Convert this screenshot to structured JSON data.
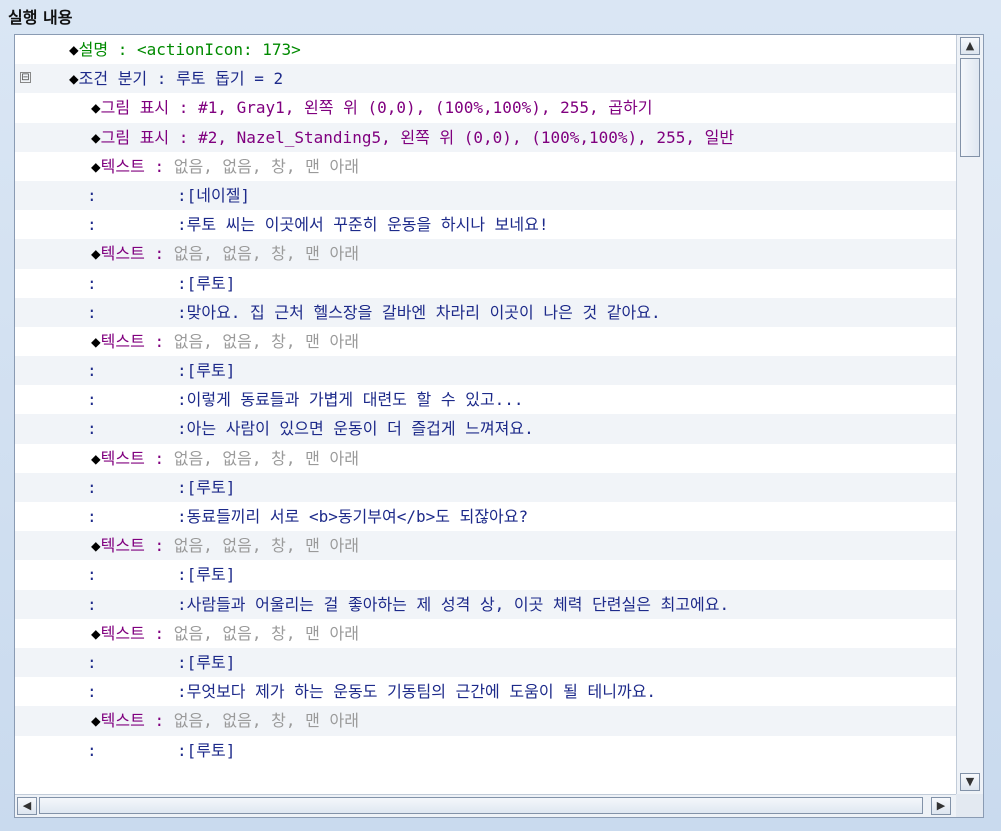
{
  "panel": {
    "title": "실행 내용"
  },
  "rows": [
    {
      "indent": 38,
      "marker": "◆",
      "label": "설명",
      "label_class": "green",
      "sep": " : ",
      "body": "<actionIcon: 173>",
      "body_class": "green"
    },
    {
      "indent": 38,
      "toggle": "⊟",
      "marker": "◆",
      "label": "조건 분기",
      "label_class": "navy",
      "sep": " : ",
      "body": "루토 돕기 = 2",
      "body_class": "navy"
    },
    {
      "indent": 60,
      "marker": "◆",
      "label": "그림 표시",
      "label_class": "purple",
      "sep": " : ",
      "body": "#1, Gray1, 왼쪽 위 (0,0), (100%,100%), 255, 곱하기",
      "body_class": "purple"
    },
    {
      "indent": 60,
      "marker": "◆",
      "label": "그림 표시",
      "label_class": "purple",
      "sep": " : ",
      "body": "#2, Nazel_Standing5, 왼쪽 위 (0,0), (100%,100%), 255, 일반",
      "body_class": "purple"
    },
    {
      "indent": 60,
      "marker": "◆",
      "label": "텍스트",
      "label_class": "purple",
      "sep": " : ",
      "body": "없음, 없음, 창, 맨 아래",
      "body_class": "gray"
    },
    {
      "cont": true,
      "colon": ":",
      "body": ":[네이젤]"
    },
    {
      "cont": true,
      "colon": ":",
      "body": ":루토 씨는 이곳에서 꾸준히 운동을 하시나 보네요!"
    },
    {
      "indent": 60,
      "marker": "◆",
      "label": "텍스트",
      "label_class": "purple",
      "sep": " : ",
      "body": "없음, 없음, 창, 맨 아래",
      "body_class": "gray"
    },
    {
      "cont": true,
      "colon": ":",
      "body": ":[루토]"
    },
    {
      "cont": true,
      "colon": ":",
      "body": ":맞아요. 집 근처 헬스장을 갈바엔 차라리 이곳이 나은 것 같아요."
    },
    {
      "indent": 60,
      "marker": "◆",
      "label": "텍스트",
      "label_class": "purple",
      "sep": " : ",
      "body": "없음, 없음, 창, 맨 아래",
      "body_class": "gray"
    },
    {
      "cont": true,
      "colon": ":",
      "body": ":[루토]"
    },
    {
      "cont": true,
      "colon": ":",
      "body": ":이렇게 동료들과 가볍게 대련도 할 수 있고..."
    },
    {
      "cont": true,
      "colon": ":",
      "body": ":아는 사람이 있으면 운동이 더 즐겁게 느껴져요."
    },
    {
      "indent": 60,
      "marker": "◆",
      "label": "텍스트",
      "label_class": "purple",
      "sep": " : ",
      "body": "없음, 없음, 창, 맨 아래",
      "body_class": "gray"
    },
    {
      "cont": true,
      "colon": ":",
      "body": ":[루토]"
    },
    {
      "cont": true,
      "colon": ":",
      "body": ":동료들끼리 서로 <b>동기부여</b>도 되잖아요?"
    },
    {
      "indent": 60,
      "marker": "◆",
      "label": "텍스트",
      "label_class": "purple",
      "sep": " : ",
      "body": "없음, 없음, 창, 맨 아래",
      "body_class": "gray"
    },
    {
      "cont": true,
      "colon": ":",
      "body": ":[루토]"
    },
    {
      "cont": true,
      "colon": ":",
      "body": ":사람들과 어울리는 걸 좋아하는 제 성격 상, 이곳 체력 단련실은 최고에요."
    },
    {
      "indent": 60,
      "marker": "◆",
      "label": "텍스트",
      "label_class": "purple",
      "sep": " : ",
      "body": "없음, 없음, 창, 맨 아래",
      "body_class": "gray"
    },
    {
      "cont": true,
      "colon": ":",
      "body": ":[루토]"
    },
    {
      "cont": true,
      "colon": ":",
      "body": ":무엇보다 제가 하는 운동도 기동팀의 근간에 도움이 될 테니까요."
    },
    {
      "indent": 60,
      "marker": "◆",
      "label": "텍스트",
      "label_class": "purple",
      "sep": " : ",
      "body": "없음, 없음, 창, 맨 아래",
      "body_class": "gray"
    },
    {
      "cont": true,
      "colon": ":",
      "body": ":[루토]"
    }
  ],
  "scrollbar": {
    "up_icon": "▲",
    "down_icon": "▼",
    "left_icon": "◀",
    "right_icon": "▶"
  }
}
